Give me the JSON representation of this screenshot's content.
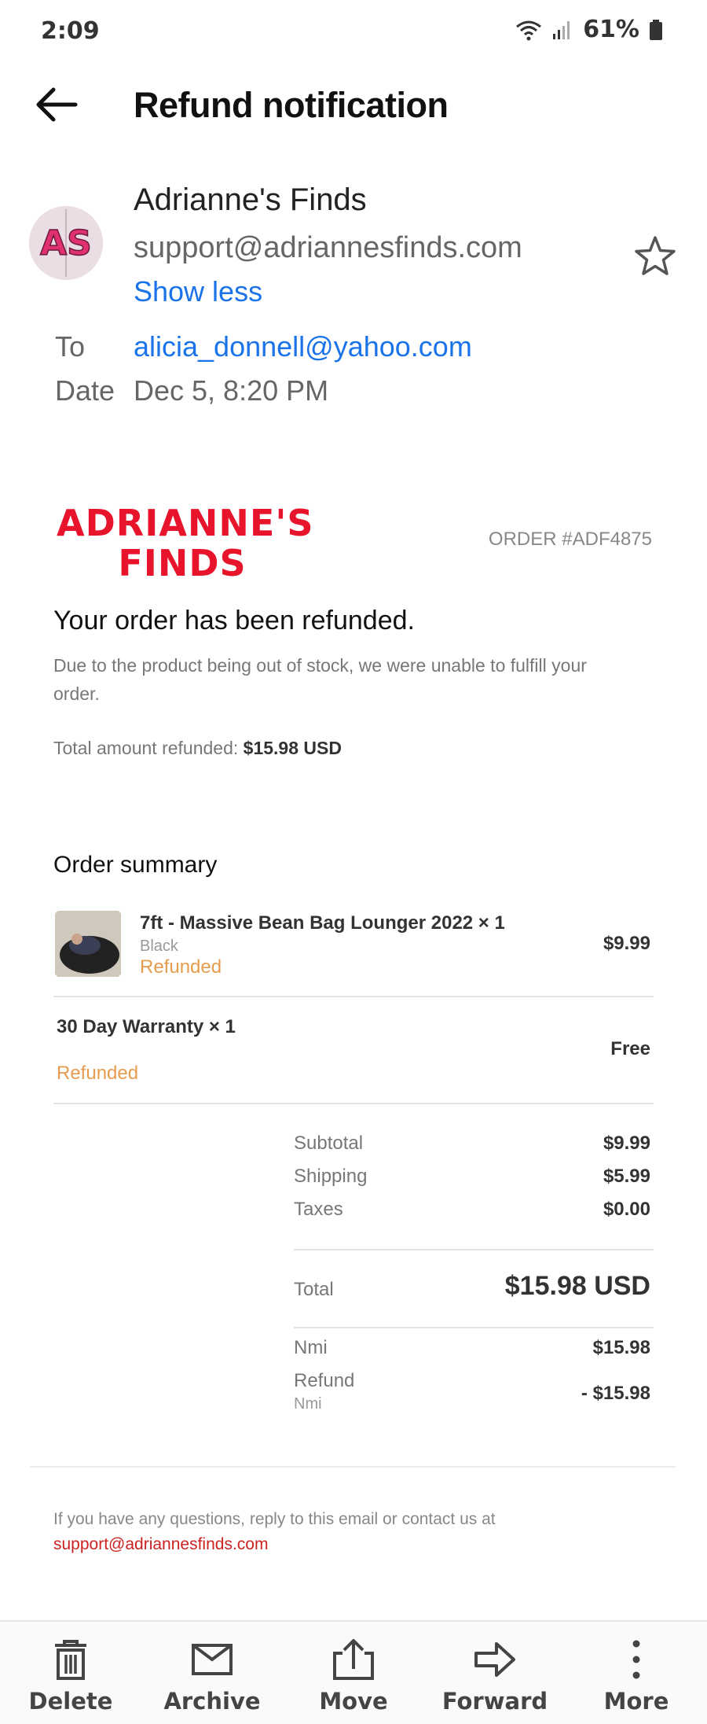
{
  "status_bar": {
    "time": "2:09",
    "battery": "61%"
  },
  "header": {
    "title": "Refund notification"
  },
  "sender": {
    "avatar_initials": "AS",
    "name": "Adrianne's Finds",
    "email": "support@adriannesfinds.com",
    "toggle": "Show less"
  },
  "meta": {
    "to_label": "To",
    "to_value": "alicia_donnell@yahoo.com",
    "date_label": "Date",
    "date_value": "Dec 5, 8:20 PM"
  },
  "email": {
    "brand_line1": "ADRIANNE'S",
    "brand_line2": "FINDS",
    "order_number": "ORDER #ADF4875",
    "headline": "Your order has been refunded.",
    "message": "Due to the product being out of stock, we were unable to fulfill your order.",
    "refund_label": "Total amount refunded: ",
    "refund_amount": "$15.98 USD",
    "summary_title": "Order summary",
    "items": [
      {
        "title": "7ft - Massive Bean Bag Lounger 2022 × 1",
        "variant": "Black",
        "status": "Refunded",
        "price": "$9.99"
      },
      {
        "title": "30 Day Warranty × 1",
        "variant": "",
        "status": "Refunded",
        "price": "Free"
      }
    ],
    "totals": {
      "subtotal_label": "Subtotal",
      "subtotal": "$9.99",
      "shipping_label": "Shipping",
      "shipping": "$5.99",
      "taxes_label": "Taxes",
      "taxes": "$0.00",
      "total_label": "Total",
      "total": "$15.98 USD",
      "nmi_label": "Nmi",
      "nmi": "$15.98",
      "refund_label": "Refund",
      "refund_sub": "Nmi",
      "refund": "- $15.98"
    },
    "contact_text": "If you have any questions, reply to this email or contact us at",
    "contact_email": "support@adriannesfinds.com"
  },
  "bottom_bar": [
    {
      "label": "Delete",
      "icon": "trash-icon"
    },
    {
      "label": "Archive",
      "icon": "archive-icon"
    },
    {
      "label": "Move",
      "icon": "move-icon"
    },
    {
      "label": "Forward",
      "icon": "forward-icon"
    },
    {
      "label": "More",
      "icon": "more-vertical-icon"
    }
  ],
  "colors": {
    "link": "#1a73e8",
    "brand": "#e8142b",
    "refunded": "#e69c4e",
    "contact_link": "#cc2222"
  }
}
